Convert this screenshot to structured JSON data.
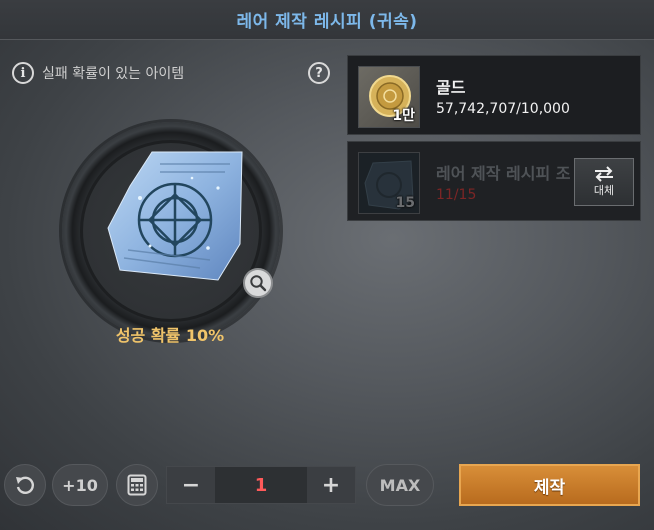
{
  "header": {
    "title": "레어 제작 레시피 (귀속)"
  },
  "info": {
    "fail_note": "실패 확률이 있는 아이템"
  },
  "icons": {
    "info": "i",
    "help": "?",
    "zoom": "magnifier-icon",
    "undo": "undo-icon",
    "calculator": "calculator-icon",
    "replace": "swap-arrows-icon"
  },
  "item": {
    "success_rate": "성공 확률 10%"
  },
  "materials": [
    {
      "name": "골드",
      "count": "57,742,707/10,000",
      "badge": "1만",
      "enough": true
    },
    {
      "name": "레어 제작 레시피 조",
      "count": "11/15",
      "badge": "15",
      "enough": false,
      "replace_label": "대체"
    }
  ],
  "controls": {
    "plus10_label": "+10",
    "minus_label": "−",
    "quantity": "1",
    "plus_label": "+",
    "max_label": "MAX",
    "craft_label": "제작"
  },
  "colors": {
    "title": "#7db8ea",
    "success_rate": "#f0c46a",
    "quantity": "#ff5a5a",
    "insufficient": "#7c2525",
    "craft_button": "#c87a2a"
  }
}
